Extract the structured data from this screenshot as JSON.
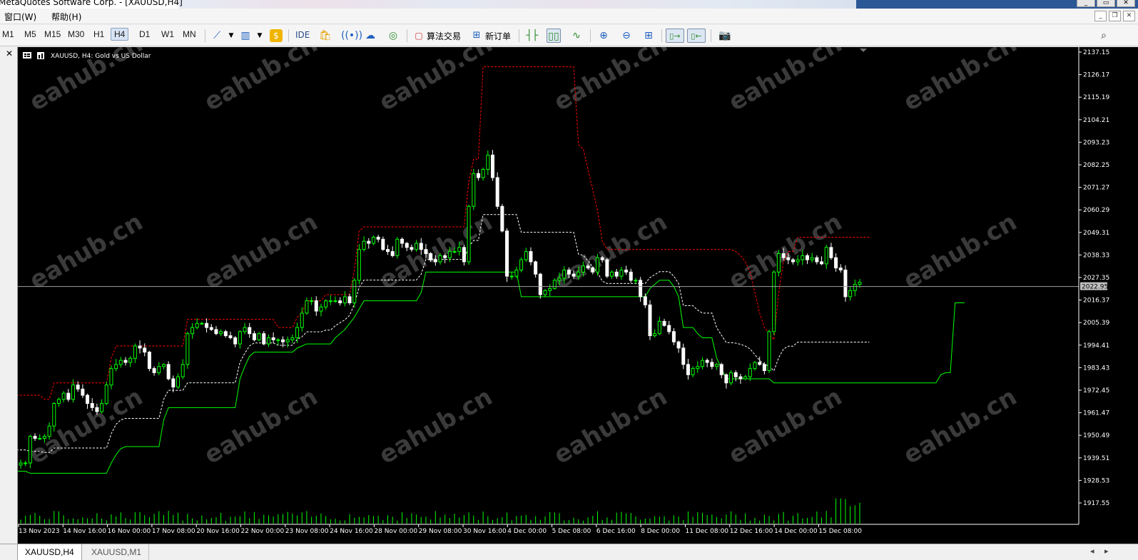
{
  "window": {
    "title": "MetaQuotes Software Corp. - [XAUUSD,H4]",
    "buttons": [
      "_",
      "▭",
      "✕"
    ]
  },
  "menu": {
    "items": [
      "窗口(W)",
      "帮助(H)"
    ],
    "mdi_buttons": [
      "_",
      "❐",
      "✕"
    ]
  },
  "toolbar": {
    "timeframes": [
      "M1",
      "M5",
      "M15",
      "M30",
      "H1",
      "H4",
      "D1",
      "W1",
      "MN"
    ],
    "active_timeframe": "H4",
    "ide_label": "IDE",
    "algo_label": "算法交易",
    "new_order_label": "新订单"
  },
  "chart": {
    "title": "XAUUSD, H4:  Gold vs US Dollar",
    "current_price": "2022.95",
    "price_ticks": [
      "2137.15",
      "2126.17",
      "2115.19",
      "2104.21",
      "2093.23",
      "2082.25",
      "2071.27",
      "2060.29",
      "2049.31",
      "2038.33",
      "2027.35",
      "2016.37",
      "2005.39",
      "1994.41",
      "1983.43",
      "1972.45",
      "1961.47",
      "1950.49",
      "1939.51",
      "1928.53",
      "1917.55"
    ],
    "time_ticks": [
      "13 Nov 2023",
      "14 Nov 16:00",
      "16 Nov 00:00",
      "17 Nov 08:00",
      "20 Nov 16:00",
      "22 Nov 00:00",
      "23 Nov 08:00",
      "24 Nov 16:00",
      "28 Nov 00:00",
      "29 Nov 08:00",
      "30 Nov 16:00",
      "4 Dec 00:00",
      "5 Dec 08:00",
      "6 Dec 16:00",
      "8 Dec 00:00",
      "11 Dec 08:00",
      "12 Dec 16:00",
      "14 Dec 00:00",
      "15 Dec 08:00"
    ],
    "watermark": "eahub.cn",
    "colors": {
      "bull": "#00ff00",
      "bear": "#ffffff",
      "upper": "#ff0000",
      "lower": "#00ff00",
      "mid": "#ffffff",
      "bg": "#000000"
    }
  },
  "chart_data": {
    "type": "candlestick",
    "symbol": "XAUUSD",
    "timeframe": "H4",
    "ylim": [
      1911,
      2140
    ],
    "close": [
      1937,
      1937,
      1950,
      1949,
      1949,
      1950,
      1955,
      1966,
      1968,
      1971,
      1968,
      1975,
      1973,
      1970,
      1966,
      1964,
      1962,
      1966,
      1975,
      1983,
      1985,
      1987,
      1986,
      1988,
      1994,
      1993,
      1991,
      1983,
      1981,
      1984,
      1985,
      1978,
      1974,
      1979,
      1985,
      2000,
      2003,
      2005,
      2005,
      2003,
      2002,
      2000,
      2001,
      1999,
      1998,
      1995,
      2001,
      2003,
      2000,
      1997,
      2000,
      1995,
      1998,
      1997,
      1997,
      1996,
      1997,
      1998,
      2003,
      2010,
      2016,
      2016,
      2011,
      2013,
      2016,
      2016,
      2016,
      2015,
      2018,
      2015,
      2026,
      2041,
      2045,
      2044,
      2047,
      2046,
      2041,
      2040,
      2038,
      2046,
      2044,
      2042,
      2041,
      2044,
      2041,
      2039,
      2036,
      2035,
      2038,
      2037,
      2040,
      2040,
      2042,
      2035,
      2062,
      2078,
      2076,
      2080,
      2087,
      2076,
      2062,
      2050,
      2028,
      2028,
      2031,
      2036,
      2040,
      2035,
      2029,
      2019,
      2021,
      2022,
      2026,
      2027,
      2031,
      2029,
      2028,
      2030,
      2033,
      2032,
      2030,
      2037,
      2036,
      2028,
      2030,
      2028,
      2031,
      2030,
      2026,
      2026,
      2018,
      2014,
      1999,
      2000,
      2006,
      2004,
      2001,
      1996,
      1993,
      1985,
      1980,
      1983,
      1984,
      1987,
      1986,
      1984,
      1985,
      1980,
      1976,
      1981,
      1979,
      1978,
      1979,
      1983,
      1986,
      1985,
      1982,
      2001,
      2030,
      2039,
      2037,
      2036,
      2035,
      2036,
      2038,
      2036,
      2037,
      2035,
      2034,
      2042,
      2037,
      2032,
      2031,
      2018,
      2021,
      2024,
      2025
    ],
    "upper": [
      1970,
      1970,
      1970,
      1970,
      1970,
      1968,
      1968,
      1976,
      1976,
      1976,
      1976,
      1976,
      1976,
      1976,
      1976,
      1976,
      1976,
      1976,
      1976,
      1988,
      1994,
      1994,
      1994,
      1994,
      1994,
      1994,
      1994,
      1994,
      1994,
      1994,
      1994,
      1994,
      1994,
      1994,
      1994,
      2007,
      2007,
      2007,
      2007,
      2007,
      2007,
      2007,
      2007,
      2007,
      2007,
      2007,
      2007,
      2007,
      2007,
      2007,
      2007,
      2007,
      2007,
      2007,
      2003,
      2003,
      2003,
      2003,
      2008,
      2010,
      2016,
      2016,
      2016,
      2016,
      2019,
      2019,
      2019,
      2019,
      2019,
      2019,
      2031,
      2050,
      2052,
      2052,
      2052,
      2052,
      2052,
      2052,
      2052,
      2052,
      2052,
      2052,
      2052,
      2052,
      2052,
      2052,
      2052,
      2052,
      2052,
      2052,
      2052,
      2052,
      2052,
      2052,
      2074,
      2085,
      2085,
      2130,
      2130,
      2130,
      2130,
      2130,
      2130,
      2130,
      2130,
      2130,
      2130,
      2130,
      2130,
      2130,
      2130,
      2130,
      2130,
      2130,
      2130,
      2130,
      2130,
      2092,
      2090,
      2080,
      2070,
      2060,
      2045,
      2041,
      2041,
      2041,
      2041,
      2041,
      2041,
      2041,
      2041,
      2041,
      2041,
      2041,
      2041,
      2041,
      2041,
      2041,
      2041,
      2041,
      2041,
      2041,
      2041,
      2041,
      2041,
      2041,
      2041,
      2041,
      2041,
      2041,
      2040,
      2038,
      2035,
      2030,
      2020,
      2010,
      2003,
      2000,
      1997,
      2020,
      2035,
      2040,
      2040,
      2047,
      2047,
      2047,
      2047,
      2047,
      2047,
      2047,
      2047,
      2047,
      2047,
      2047,
      2047,
      2047,
      2047,
      2047,
      2047
    ],
    "lower": [
      1933,
      1933,
      1932,
      1932,
      1932,
      1932,
      1932,
      1932,
      1932,
      1932,
      1932,
      1932,
      1932,
      1932,
      1932,
      1932,
      1932,
      1932,
      1932,
      1937,
      1941,
      1944,
      1945,
      1945,
      1945,
      1945,
      1945,
      1945,
      1945,
      1945,
      1958,
      1964,
      1964,
      1964,
      1964,
      1964,
      1964,
      1964,
      1964,
      1964,
      1964,
      1964,
      1964,
      1964,
      1964,
      1964,
      1978,
      1984,
      1989,
      1991,
      1991,
      1991,
      1991,
      1991,
      1991,
      1991,
      1991,
      1991,
      1993,
      1994,
      1995,
      1995,
      1995,
      1995,
      1995,
      1995,
      1998,
      2000,
      2002,
      2005,
      2008,
      2012,
      2016,
      2016,
      2016,
      2016,
      2016,
      2016,
      2016,
      2016,
      2016,
      2016,
      2016,
      2016,
      2020,
      2030,
      2030,
      2030,
      2030,
      2030,
      2030,
      2030,
      2030,
      2030,
      2030,
      2030,
      2030,
      2030,
      2030,
      2030,
      2030,
      2030,
      2030,
      2030,
      2030,
      2018,
      2018,
      2018,
      2018,
      2018,
      2018,
      2018,
      2018,
      2018,
      2018,
      2018,
      2018,
      2018,
      2018,
      2018,
      2018,
      2018,
      2018,
      2018,
      2018,
      2018,
      2018,
      2018,
      2018,
      2018,
      2018,
      2018,
      2022,
      2024,
      2026,
      2026,
      2026,
      2023,
      2018,
      2003,
      2003,
      2003,
      2000,
      1998,
      1998,
      1998,
      1988,
      1983,
      1978,
      1978,
      1978,
      1978,
      1978,
      1978,
      1978,
      1978,
      1978,
      1978,
      1976,
      1976,
      1976,
      1976,
      1976,
      1976,
      1976,
      1976,
      1976,
      1976,
      1976,
      1976,
      1976,
      1976,
      1976,
      1976,
      1976,
      1976,
      1976,
      1976,
      1976,
      1976,
      1976,
      1976,
      1976,
      1976,
      1976,
      1976,
      1976,
      1976,
      1976,
      1976,
      1976,
      1976,
      1976,
      1980,
      1981,
      1981,
      2015,
      2015,
      2015
    ]
  },
  "tabs": [
    "XAUUSD,H4",
    "XAUUSD,M1"
  ]
}
